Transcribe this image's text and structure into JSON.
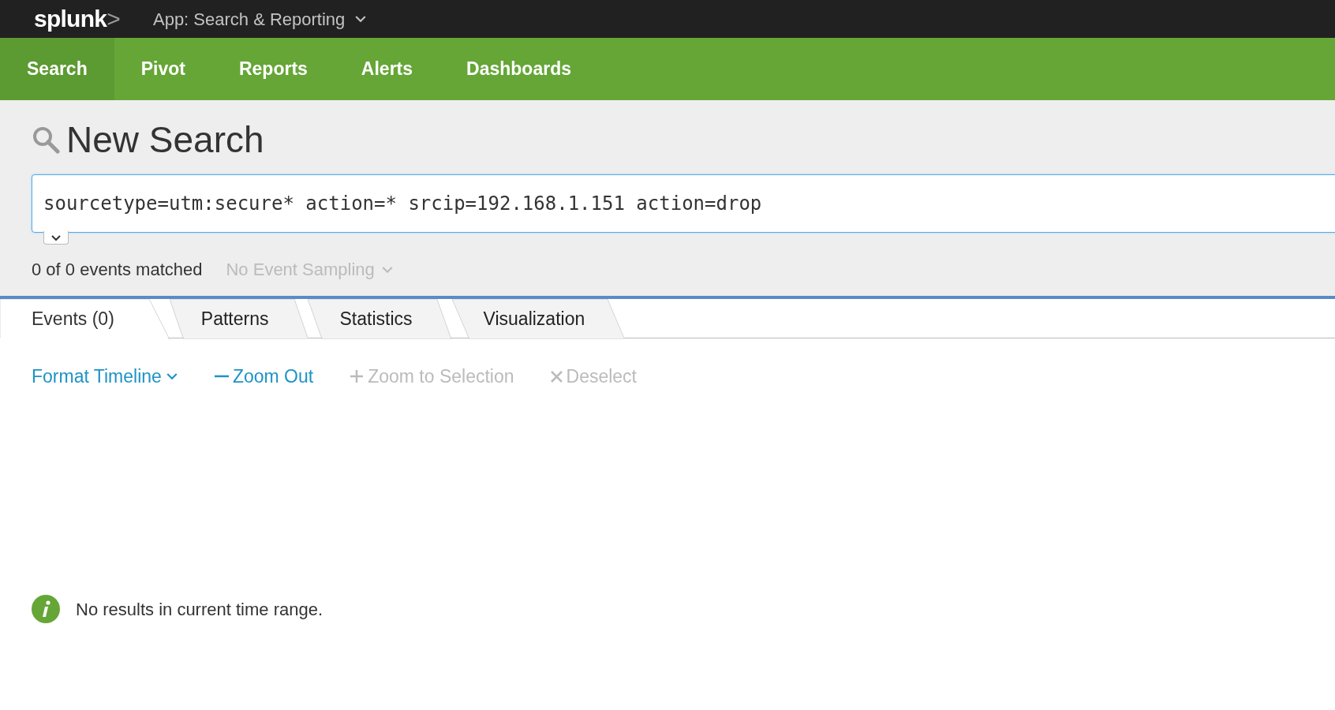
{
  "top_bar": {
    "logo": {
      "text": "splunk",
      "accent": ">"
    },
    "app_menu": {
      "label": "App: Search & Reporting"
    }
  },
  "nav": [
    {
      "label": "Search",
      "selected": true
    },
    {
      "label": "Pivot",
      "selected": false
    },
    {
      "label": "Reports",
      "selected": false
    },
    {
      "label": "Alerts",
      "selected": false
    },
    {
      "label": "Dashboards",
      "selected": false
    }
  ],
  "search": {
    "title": "New Search",
    "expanded": false,
    "query": "sourcetype=utm:secure* action=* srcip=192.168.1.151 action=drop",
    "status": "0 of 0 events matched",
    "sampling": {
      "label": "No Event Sampling",
      "disabled": true
    }
  },
  "tabs": [
    {
      "label": "Events (0)",
      "selected": true
    },
    {
      "label": "Patterns",
      "selected": false
    },
    {
      "label": "Statistics",
      "selected": false
    },
    {
      "label": "Visualization",
      "selected": false
    }
  ],
  "timeline_actions": [
    {
      "kind": "dropdown",
      "label": "Format Timeline",
      "disabled": false
    },
    {
      "kind": "minus",
      "label": "Zoom Out",
      "disabled": false
    },
    {
      "kind": "plus",
      "label": "Zoom to Selection",
      "disabled": true
    },
    {
      "kind": "close",
      "label": "Deselect",
      "disabled": true
    }
  ],
  "message": {
    "kind": "info",
    "text": "No results in current time range."
  }
}
